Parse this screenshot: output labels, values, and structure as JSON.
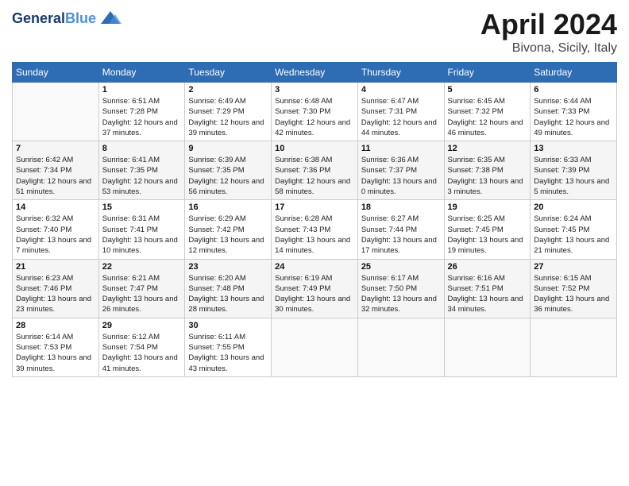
{
  "header": {
    "logo_line1": "General",
    "logo_line2": "Blue",
    "month": "April 2024",
    "location": "Bivona, Sicily, Italy"
  },
  "weekdays": [
    "Sunday",
    "Monday",
    "Tuesday",
    "Wednesday",
    "Thursday",
    "Friday",
    "Saturday"
  ],
  "weeks": [
    [
      {
        "day": "",
        "sunrise": "",
        "sunset": "",
        "daylight": ""
      },
      {
        "day": "1",
        "sunrise": "Sunrise: 6:51 AM",
        "sunset": "Sunset: 7:28 PM",
        "daylight": "Daylight: 12 hours and 37 minutes."
      },
      {
        "day": "2",
        "sunrise": "Sunrise: 6:49 AM",
        "sunset": "Sunset: 7:29 PM",
        "daylight": "Daylight: 12 hours and 39 minutes."
      },
      {
        "day": "3",
        "sunrise": "Sunrise: 6:48 AM",
        "sunset": "Sunset: 7:30 PM",
        "daylight": "Daylight: 12 hours and 42 minutes."
      },
      {
        "day": "4",
        "sunrise": "Sunrise: 6:47 AM",
        "sunset": "Sunset: 7:31 PM",
        "daylight": "Daylight: 12 hours and 44 minutes."
      },
      {
        "day": "5",
        "sunrise": "Sunrise: 6:45 AM",
        "sunset": "Sunset: 7:32 PM",
        "daylight": "Daylight: 12 hours and 46 minutes."
      },
      {
        "day": "6",
        "sunrise": "Sunrise: 6:44 AM",
        "sunset": "Sunset: 7:33 PM",
        "daylight": "Daylight: 12 hours and 49 minutes."
      }
    ],
    [
      {
        "day": "7",
        "sunrise": "Sunrise: 6:42 AM",
        "sunset": "Sunset: 7:34 PM",
        "daylight": "Daylight: 12 hours and 51 minutes."
      },
      {
        "day": "8",
        "sunrise": "Sunrise: 6:41 AM",
        "sunset": "Sunset: 7:35 PM",
        "daylight": "Daylight: 12 hours and 53 minutes."
      },
      {
        "day": "9",
        "sunrise": "Sunrise: 6:39 AM",
        "sunset": "Sunset: 7:35 PM",
        "daylight": "Daylight: 12 hours and 56 minutes."
      },
      {
        "day": "10",
        "sunrise": "Sunrise: 6:38 AM",
        "sunset": "Sunset: 7:36 PM",
        "daylight": "Daylight: 12 hours and 58 minutes."
      },
      {
        "day": "11",
        "sunrise": "Sunrise: 6:36 AM",
        "sunset": "Sunset: 7:37 PM",
        "daylight": "Daylight: 13 hours and 0 minutes."
      },
      {
        "day": "12",
        "sunrise": "Sunrise: 6:35 AM",
        "sunset": "Sunset: 7:38 PM",
        "daylight": "Daylight: 13 hours and 3 minutes."
      },
      {
        "day": "13",
        "sunrise": "Sunrise: 6:33 AM",
        "sunset": "Sunset: 7:39 PM",
        "daylight": "Daylight: 13 hours and 5 minutes."
      }
    ],
    [
      {
        "day": "14",
        "sunrise": "Sunrise: 6:32 AM",
        "sunset": "Sunset: 7:40 PM",
        "daylight": "Daylight: 13 hours and 7 minutes."
      },
      {
        "day": "15",
        "sunrise": "Sunrise: 6:31 AM",
        "sunset": "Sunset: 7:41 PM",
        "daylight": "Daylight: 13 hours and 10 minutes."
      },
      {
        "day": "16",
        "sunrise": "Sunrise: 6:29 AM",
        "sunset": "Sunset: 7:42 PM",
        "daylight": "Daylight: 13 hours and 12 minutes."
      },
      {
        "day": "17",
        "sunrise": "Sunrise: 6:28 AM",
        "sunset": "Sunset: 7:43 PM",
        "daylight": "Daylight: 13 hours and 14 minutes."
      },
      {
        "day": "18",
        "sunrise": "Sunrise: 6:27 AM",
        "sunset": "Sunset: 7:44 PM",
        "daylight": "Daylight: 13 hours and 17 minutes."
      },
      {
        "day": "19",
        "sunrise": "Sunrise: 6:25 AM",
        "sunset": "Sunset: 7:45 PM",
        "daylight": "Daylight: 13 hours and 19 minutes."
      },
      {
        "day": "20",
        "sunrise": "Sunrise: 6:24 AM",
        "sunset": "Sunset: 7:45 PM",
        "daylight": "Daylight: 13 hours and 21 minutes."
      }
    ],
    [
      {
        "day": "21",
        "sunrise": "Sunrise: 6:23 AM",
        "sunset": "Sunset: 7:46 PM",
        "daylight": "Daylight: 13 hours and 23 minutes."
      },
      {
        "day": "22",
        "sunrise": "Sunrise: 6:21 AM",
        "sunset": "Sunset: 7:47 PM",
        "daylight": "Daylight: 13 hours and 26 minutes."
      },
      {
        "day": "23",
        "sunrise": "Sunrise: 6:20 AM",
        "sunset": "Sunset: 7:48 PM",
        "daylight": "Daylight: 13 hours and 28 minutes."
      },
      {
        "day": "24",
        "sunrise": "Sunrise: 6:19 AM",
        "sunset": "Sunset: 7:49 PM",
        "daylight": "Daylight: 13 hours and 30 minutes."
      },
      {
        "day": "25",
        "sunrise": "Sunrise: 6:17 AM",
        "sunset": "Sunset: 7:50 PM",
        "daylight": "Daylight: 13 hours and 32 minutes."
      },
      {
        "day": "26",
        "sunrise": "Sunrise: 6:16 AM",
        "sunset": "Sunset: 7:51 PM",
        "daylight": "Daylight: 13 hours and 34 minutes."
      },
      {
        "day": "27",
        "sunrise": "Sunrise: 6:15 AM",
        "sunset": "Sunset: 7:52 PM",
        "daylight": "Daylight: 13 hours and 36 minutes."
      }
    ],
    [
      {
        "day": "28",
        "sunrise": "Sunrise: 6:14 AM",
        "sunset": "Sunset: 7:53 PM",
        "daylight": "Daylight: 13 hours and 39 minutes."
      },
      {
        "day": "29",
        "sunrise": "Sunrise: 6:12 AM",
        "sunset": "Sunset: 7:54 PM",
        "daylight": "Daylight: 13 hours and 41 minutes."
      },
      {
        "day": "30",
        "sunrise": "Sunrise: 6:11 AM",
        "sunset": "Sunset: 7:55 PM",
        "daylight": "Daylight: 13 hours and 43 minutes."
      },
      {
        "day": "",
        "sunrise": "",
        "sunset": "",
        "daylight": ""
      },
      {
        "day": "",
        "sunrise": "",
        "sunset": "",
        "daylight": ""
      },
      {
        "day": "",
        "sunrise": "",
        "sunset": "",
        "daylight": ""
      },
      {
        "day": "",
        "sunrise": "",
        "sunset": "",
        "daylight": ""
      }
    ]
  ]
}
